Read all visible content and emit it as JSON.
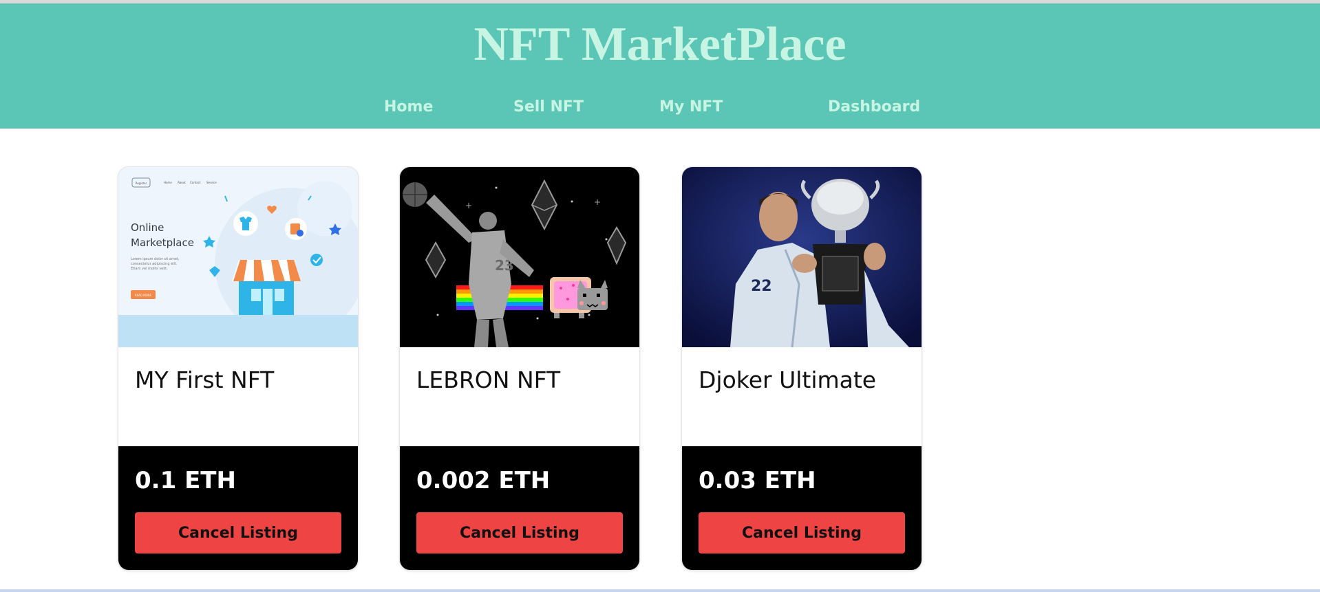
{
  "header": {
    "title": "NFT MarketPlace",
    "nav": [
      {
        "label": "Home"
      },
      {
        "label": "Sell NFT"
      },
      {
        "label": "My NFT"
      },
      {
        "label": "Dashboard"
      }
    ]
  },
  "listings": [
    {
      "name": "MY First NFT",
      "price": "0.1 ETH",
      "button_label": "Cancel Listing",
      "image": {
        "title_lines": [
          "Online",
          "Marketplace"
        ],
        "nav_labels": [
          "Register",
          "Home",
          "About",
          "Contact",
          "Service"
        ],
        "body_lines": [
          "Lorem ipsum dolor sit amet,",
          "consectetur adipiscing elit.",
          "Etiam vel mollis velit."
        ],
        "cta_label": "READ MORE"
      }
    },
    {
      "name": "LEBRON NFT",
      "price": "0.002 ETH",
      "button_label": "Cancel Listing",
      "image": {
        "jersey_number": "23"
      }
    },
    {
      "name": "Djoker Ultimate",
      "price": "0.03 ETH",
      "button_label": "Cancel Listing",
      "image": {
        "jersey_number": "22"
      }
    }
  ],
  "colors": {
    "header_bg": "#5bc6b5",
    "header_text": "#c8f5e3",
    "cancel_button": "#ef4444",
    "card_footer": "#000000"
  }
}
